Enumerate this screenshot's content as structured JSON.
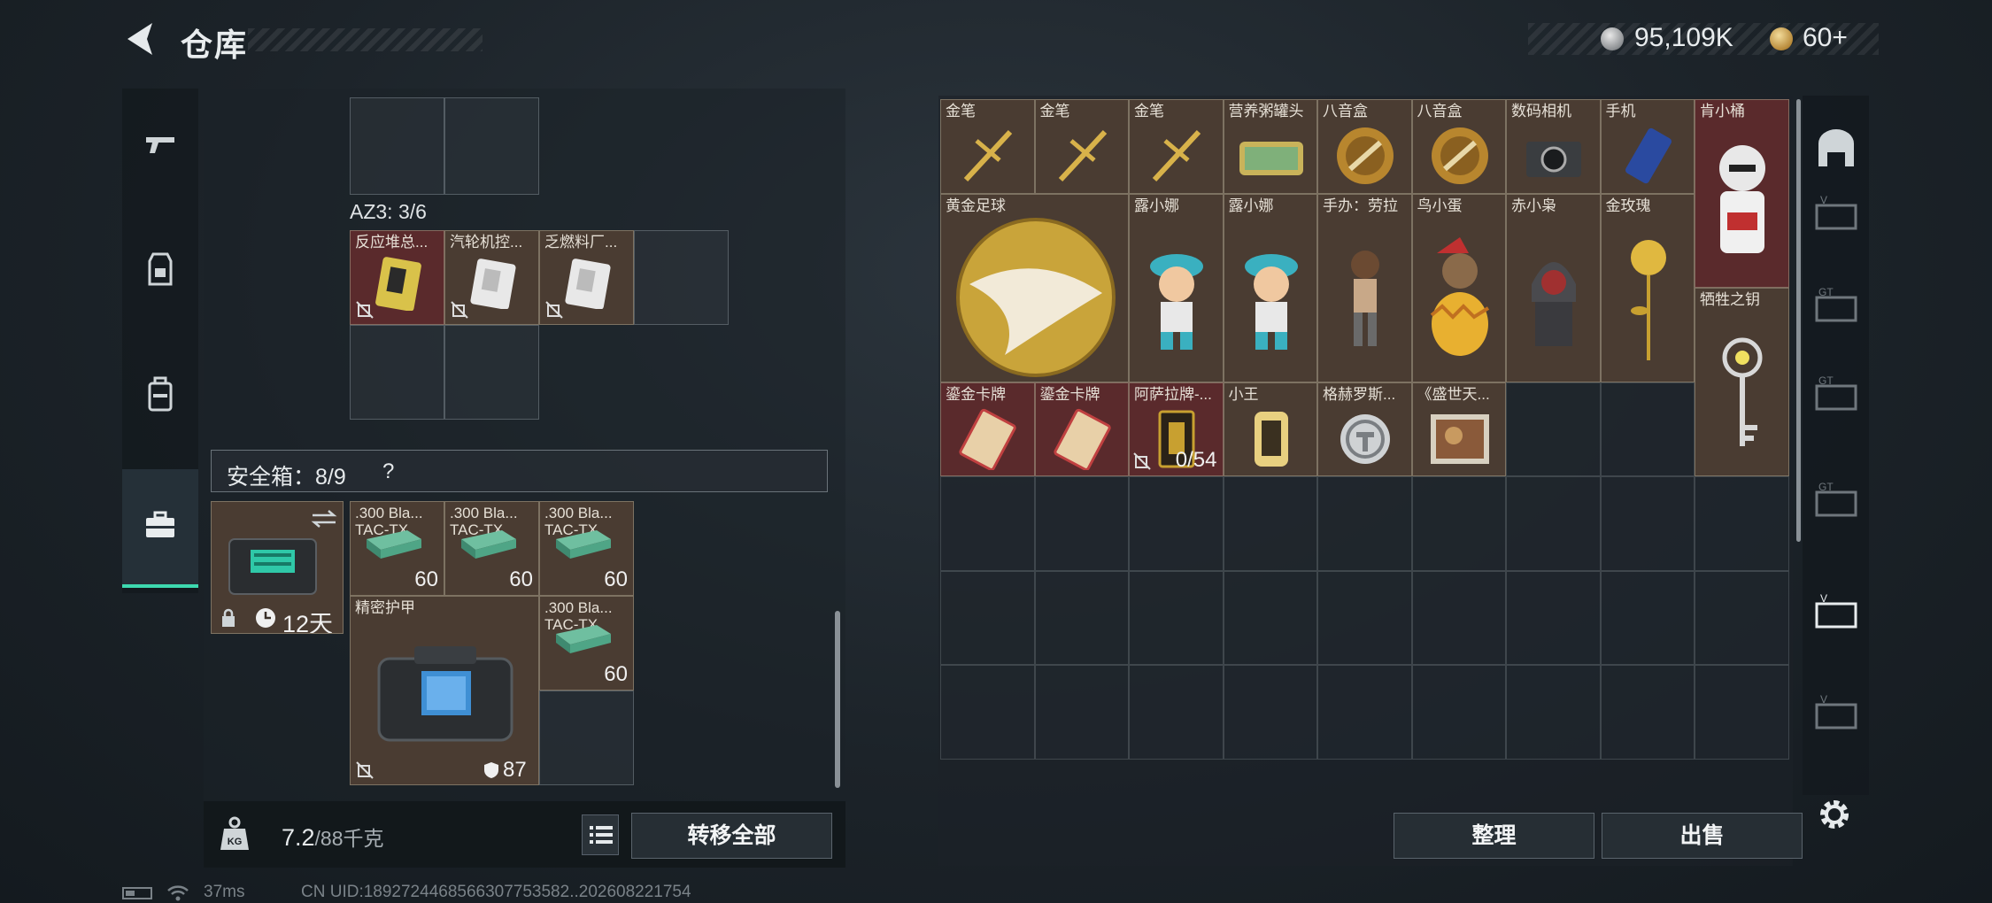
{
  "header": {
    "title": "仓库"
  },
  "currency": {
    "silver": "95,109K",
    "gold": "60+"
  },
  "left_tabs": [
    "pistol-icon",
    "vest-icon",
    "backpack-icon",
    "briefcase-icon"
  ],
  "container": {
    "label": "AZ3: 3/6",
    "items": [
      {
        "name": "反应堆总...",
        "color": "red"
      },
      {
        "name": "汽轮机控...",
        "color": "brown"
      },
      {
        "name": "乏燃料厂...",
        "color": "brown"
      }
    ]
  },
  "safe_box": {
    "label": "安全箱：8/9",
    "help": "?",
    "timer": "12天",
    "ammo": [
      {
        "name": ".300 Bla...",
        "sub": "TAC-TX",
        "count": "60"
      },
      {
        "name": ".300 Bla...",
        "sub": "TAC-TX",
        "count": "60"
      },
      {
        "name": ".300 Bla...",
        "sub": "TAC-TX",
        "count": "60"
      },
      {
        "name": ".300 Bla...",
        "sub": "TAC-TX",
        "count": "60"
      }
    ],
    "armor": {
      "name": "精密护甲",
      "durability": "87"
    }
  },
  "weight": {
    "current": "7.2",
    "capacity": "/88千克"
  },
  "buttons": {
    "transfer_all": "转移全部",
    "sort": "整理",
    "sell": "出售"
  },
  "stash_items": [
    {
      "name": "金笔"
    },
    {
      "name": "金笔"
    },
    {
      "name": "金笔"
    },
    {
      "name": "营养粥罐头"
    },
    {
      "name": "八音盒"
    },
    {
      "name": "八音盒"
    },
    {
      "name": "数码相机"
    },
    {
      "name": "手机"
    },
    {
      "name": "肯小桶"
    },
    {
      "name": "黄金足球"
    },
    {
      "name": "露小娜"
    },
    {
      "name": "露小娜"
    },
    {
      "name": "手办：劳拉"
    },
    {
      "name": "鸟小蛋"
    },
    {
      "name": "赤小枭"
    },
    {
      "name": "金玫瑰"
    },
    {
      "name": "牺牲之钥"
    },
    {
      "name": "鎏金卡牌"
    },
    {
      "name": "鎏金卡牌"
    },
    {
      "name": "阿萨拉牌-...",
      "count": "0/54"
    },
    {
      "name": "小王"
    },
    {
      "name": "格赫罗斯..."
    },
    {
      "name": "《盛世天..."
    }
  ],
  "status_bar": {
    "ping": "37ms",
    "uid": "CN UID:1892724468566307753582..202608221754"
  }
}
